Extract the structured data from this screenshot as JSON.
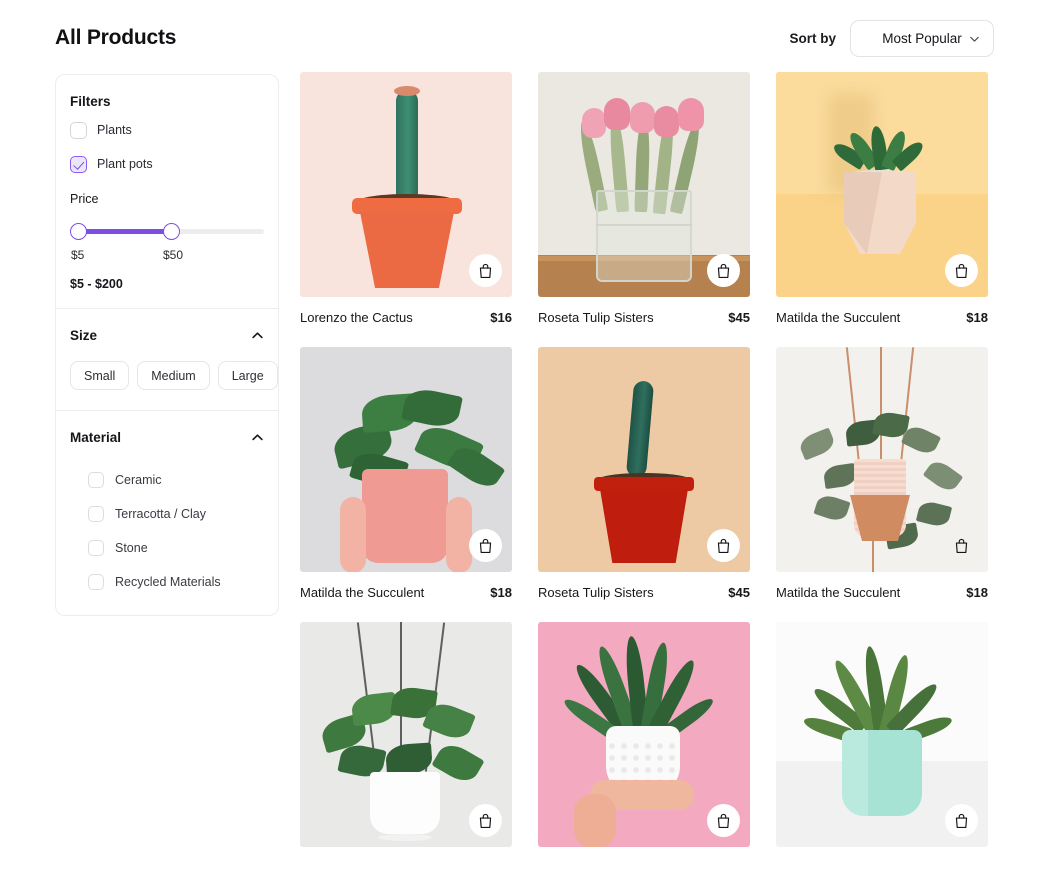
{
  "header": {
    "title": "All Products",
    "sort_label": "Sort by",
    "sort_value": "Most Popular",
    "chevron_icon": "chevron-down-icon"
  },
  "sidebar": {
    "filters_title": "Filters",
    "category_checkboxes": [
      {
        "label": "Plants",
        "checked": false
      },
      {
        "label": "Plant pots",
        "checked": true
      }
    ],
    "price": {
      "title": "Price",
      "min_tick": "$5",
      "max_tick": "$50",
      "range_readout": "$5 - $200"
    },
    "size": {
      "title": "Size",
      "chevron_icon": "chevron-up-icon",
      "options": [
        "Small",
        "Medium",
        "Large"
      ]
    },
    "material": {
      "title": "Material",
      "chevron_icon": "chevron-up-icon",
      "options": [
        {
          "label": "Ceramic",
          "checked": false
        },
        {
          "label": "Terracotta / Clay",
          "checked": false
        },
        {
          "label": "Stone",
          "checked": false
        },
        {
          "label": "Recycled Materials",
          "checked": false
        }
      ]
    }
  },
  "products": [
    {
      "name": "Lorenzo the Cactus",
      "price": "$16",
      "cart_icon": "shopping-bag-icon"
    },
    {
      "name": "Roseta Tulip Sisters",
      "price": "$45",
      "cart_icon": "shopping-bag-icon"
    },
    {
      "name": "Matilda the Succulent",
      "price": "$18",
      "cart_icon": "shopping-bag-icon"
    },
    {
      "name": "Matilda the Succulent",
      "price": "$18",
      "cart_icon": "shopping-bag-icon"
    },
    {
      "name": "Roseta Tulip Sisters",
      "price": "$45",
      "cart_icon": "shopping-bag-icon"
    },
    {
      "name": "Matilda the Succulent",
      "price": "$18",
      "cart_icon": "shopping-bag-icon"
    },
    {
      "name": "",
      "price": "",
      "cart_icon": "shopping-bag-icon"
    },
    {
      "name": "",
      "price": "",
      "cart_icon": "shopping-bag-icon"
    },
    {
      "name": "",
      "price": "",
      "cart_icon": "shopping-bag-icon"
    }
  ],
  "colors": {
    "accent_purple": "#7c4fe0",
    "checkbox_fill": "#ece6fb",
    "border": "#ededf0",
    "text": "#17171c"
  }
}
